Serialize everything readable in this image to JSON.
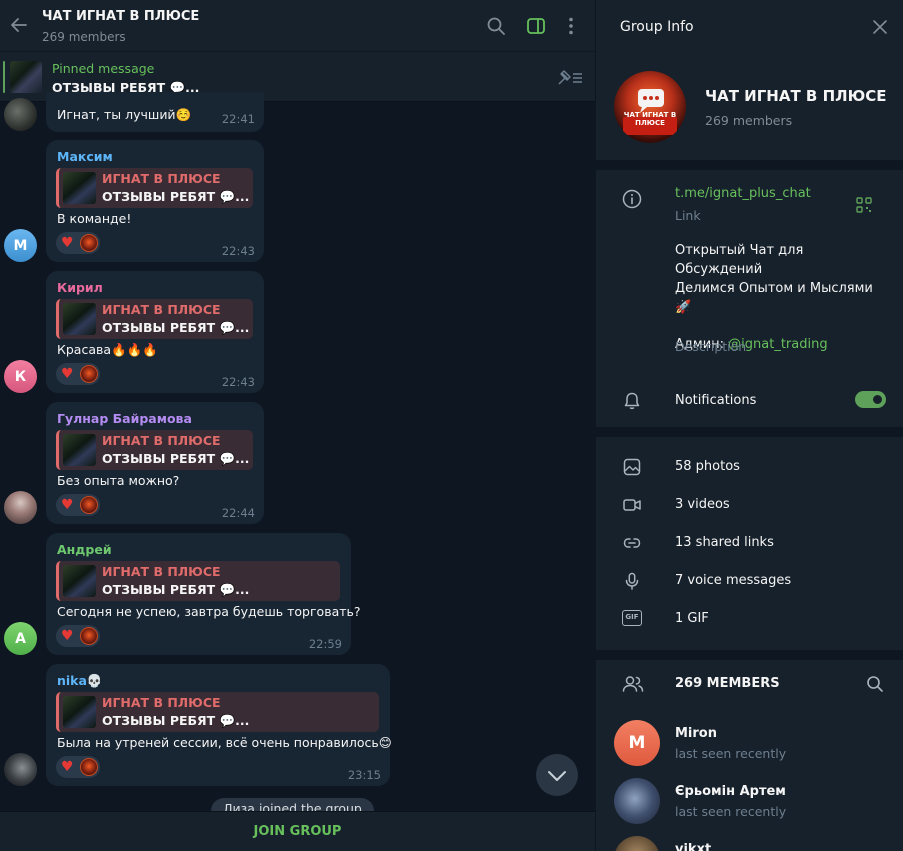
{
  "chat": {
    "title": "ЧАТ ИГНАТ В ПЛЮСЕ",
    "subtitle": "269 members",
    "pinned_label": "Pinned message",
    "pinned_text": "ОТЗЫВЫ РЕБЯТ 💬...",
    "messages": [
      {
        "text": "Игнат, ты лучший☺️",
        "time": "22:41"
      },
      {
        "author": "Максим",
        "author_color": "#5eb5f7",
        "avatar_letter": "М",
        "reply_title": "ИГНАТ В ПЛЮСЕ",
        "reply_text": "ОТЗЫВЫ РЕБЯТ 💬...",
        "text": "В команде!",
        "time": "22:43"
      },
      {
        "author": "Кирил",
        "author_color": "#e96a9d",
        "avatar_letter": "К",
        "reply_title": "ИГНАТ В ПЛЮСЕ",
        "reply_text": "ОТЗЫВЫ РЕБЯТ 💬...",
        "text": "Красава🔥🔥🔥",
        "time": "22:43"
      },
      {
        "author": "Гулнар Байрамова",
        "author_color": "#b48cf2",
        "reply_title": "ИГНАТ В ПЛЮСЕ",
        "reply_text": "ОТЗЫВЫ РЕБЯТ 💬...",
        "text": "Без опыта можно?",
        "time": "22:44"
      },
      {
        "author": "Андрей",
        "author_color": "#6ec96e",
        "avatar_letter": "А",
        "reply_title": "ИГНАТ В ПЛЮСЕ",
        "reply_text": "ОТЗЫВЫ РЕБЯТ 💬...",
        "text": "Сегодня не успею, завтра будешь торговать?",
        "time": "22:59"
      },
      {
        "author": "nika💀",
        "author_color": "#5eb5f7",
        "reply_title": "ИГНАТ В ПЛЮСЕ",
        "reply_text": "ОТЗЫВЫ РЕБЯТ 💬...",
        "text": "Была на утреней сессии, всё очень понравилось😊",
        "time": "23:15"
      }
    ],
    "service_message": "Лиза joined the group",
    "join_button": "JOIN GROUP"
  },
  "info": {
    "title": "Group Info",
    "group_name": "ЧАТ ИГНАТ В ПЛЮСЕ",
    "group_members": "269 members",
    "avatar_caption": "ЧАТ ИГНАТ В ПЛЮСЕ",
    "link": "t.me/ignat_plus_chat",
    "link_label": "Link",
    "description_line1": "Открытый Чат для Обсуждений",
    "description_line2": "Делимся Опытом и Мыслями",
    "description_line3": "🚀",
    "admin_prefix": "Админ: ",
    "admin_handle": "@ignat_trading",
    "description_label": "Description",
    "notifications_label": "Notifications",
    "notifications_on": true,
    "media": {
      "photos": "58 photos",
      "videos": "3 videos",
      "links": "13 shared links",
      "voice": "7 voice messages",
      "gif": "1 GIF",
      "gif_icon_text": "GIF"
    },
    "members_header": "269 MEMBERS",
    "members": [
      {
        "name": "Miron",
        "status": "last seen recently",
        "avatar_letter": "M",
        "avatar_color": "#e8684a"
      },
      {
        "name": "Єрьомін Артем",
        "status": "last seen recently"
      },
      {
        "name": "vikxt"
      }
    ]
  },
  "colors": {
    "accent_green": "#67c05c",
    "bubble_bg": "#182533",
    "panel_bg": "#17212b",
    "chat_bg": "#0e1621"
  }
}
